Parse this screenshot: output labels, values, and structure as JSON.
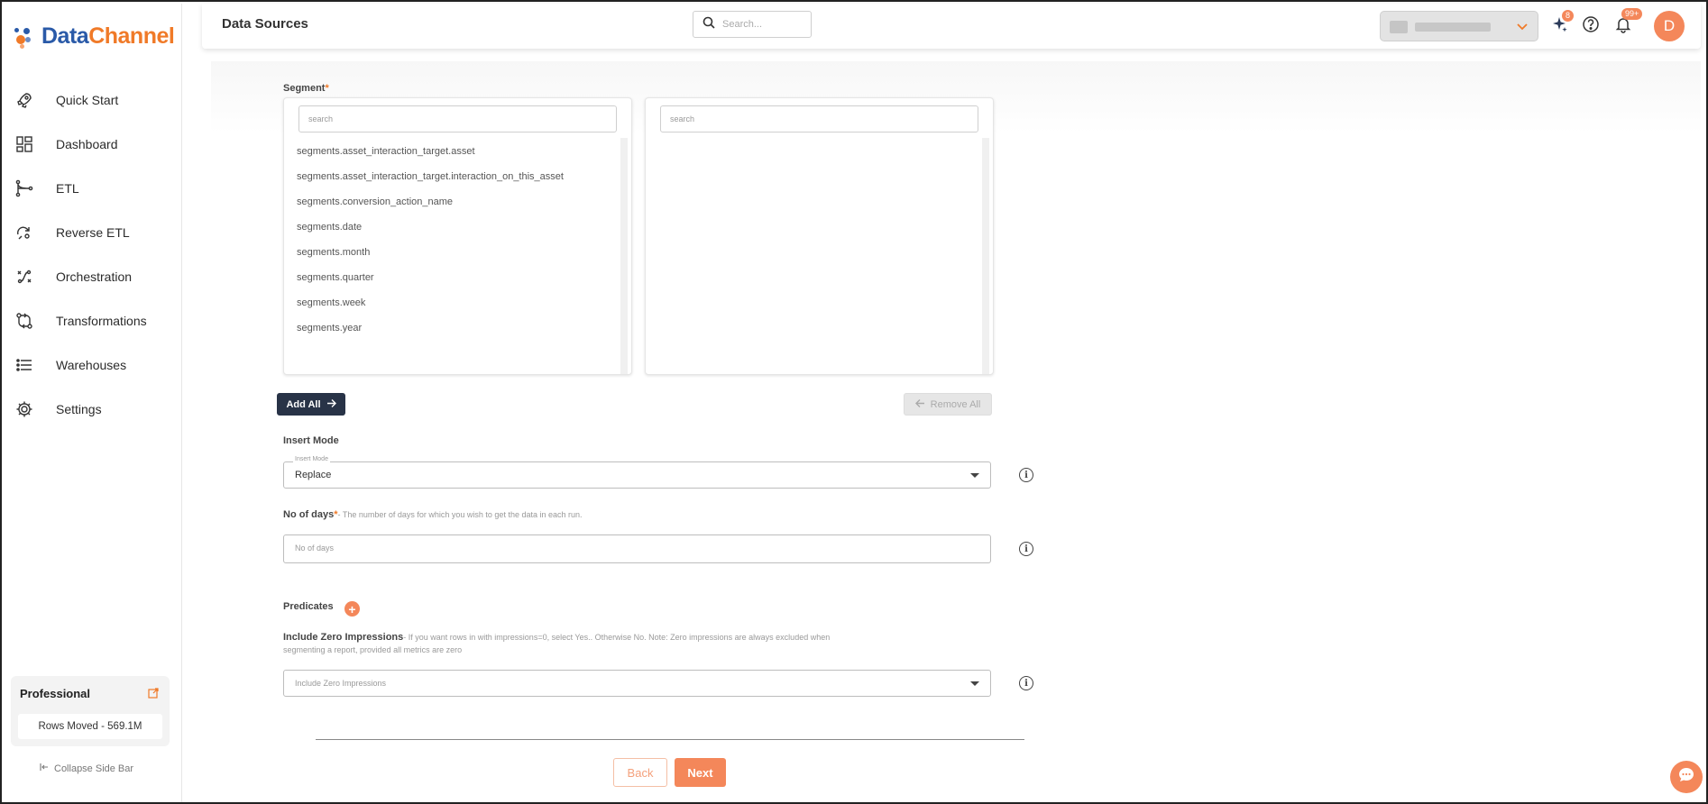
{
  "brand": {
    "data": "Data",
    "channel": "Channel"
  },
  "sidebar": {
    "items": [
      {
        "label": "Quick Start",
        "icon": "rocket-icon"
      },
      {
        "label": "Dashboard",
        "icon": "dashboard-icon"
      },
      {
        "label": "ETL",
        "icon": "etl-icon"
      },
      {
        "label": "Reverse ETL",
        "icon": "reverse-etl-icon"
      },
      {
        "label": "Orchestration",
        "icon": "orchestration-icon"
      },
      {
        "label": "Transformations",
        "icon": "transformations-icon"
      },
      {
        "label": "Warehouses",
        "icon": "warehouses-icon"
      },
      {
        "label": "Settings",
        "icon": "gear-icon"
      }
    ],
    "plan": {
      "title": "Professional",
      "rows_moved": "Rows Moved - 569.1M"
    },
    "collapse_label": "Collapse Side Bar"
  },
  "header": {
    "title": "Data Sources",
    "search_placeholder": "Search...",
    "ai_badge": "8",
    "notif_badge": "99+",
    "avatar_initial": "D"
  },
  "segment": {
    "label": "Segment",
    "required_mark": "*",
    "left_search_placeholder": "search",
    "right_search_placeholder": "search",
    "available": [
      "segments.asset_interaction_target.asset",
      "segments.asset_interaction_target.interaction_on_this_asset",
      "segments.conversion_action_name",
      "segments.date",
      "segments.month",
      "segments.quarter",
      "segments.week",
      "segments.year"
    ],
    "selected": [],
    "add_all_label": "Add All",
    "remove_all_label": "Remove All"
  },
  "insert_mode": {
    "label": "Insert Mode",
    "float_label": "Insert Mode",
    "value": "Replace"
  },
  "no_of_days": {
    "label": "No of days",
    "required_mark": "*",
    "hint": "- The number of days for which you wish to get the data in each run.",
    "placeholder": "No of days"
  },
  "predicates": {
    "label": "Predicates"
  },
  "include_zero": {
    "label": "Include Zero Impressions",
    "hint_line1": "- If you want rows in with impressions=0, select Yes.. Otherwise No. Note: Zero impressions are always excluded when",
    "hint_line2": "segmenting a report, provided all metrics are zero",
    "placeholder": "Include Zero Impressions"
  },
  "footer": {
    "back_label": "Back",
    "next_label": "Next"
  },
  "colors": {
    "accent": "#f4875a",
    "dark_button": "#283347",
    "brand_blue": "#2a5aa8",
    "brand_orange": "#f07a28"
  }
}
